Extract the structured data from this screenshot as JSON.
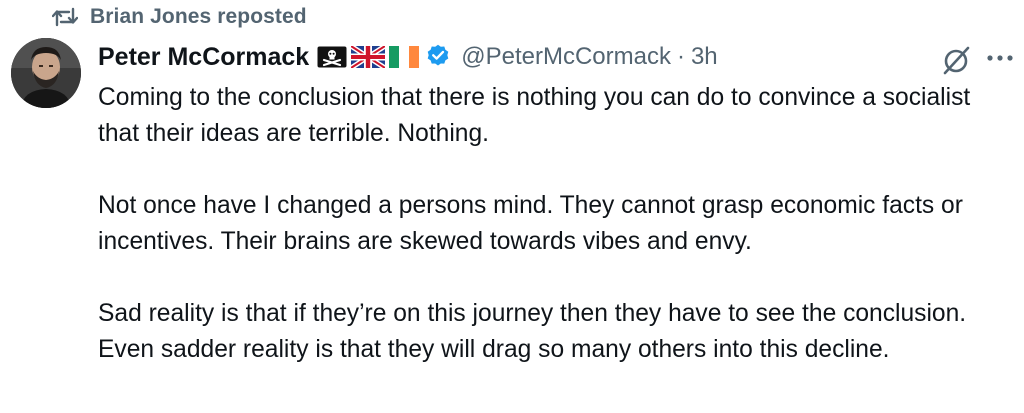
{
  "social_context": {
    "icon": "repost-icon",
    "text": "Brian Jones reposted"
  },
  "author": {
    "display_name": "Peter McCormack",
    "name_badges": [
      "skull-crossbones-flag-icon",
      "uk-flag-icon",
      "ireland-flag-icon"
    ],
    "verified_icon": "verified-badge-icon",
    "handle": "@PeterMcCormack",
    "separator": "·",
    "timestamp": "3h"
  },
  "actions": {
    "grok_icon": "grok-icon",
    "more_icon": "more-options-icon"
  },
  "tweet": {
    "paragraphs": [
      "Coming to the conclusion that there is nothing you can do to convince a socialist that their ideas are terrible. Nothing.",
      "Not once have I changed a persons mind. They cannot grasp economic facts or incentives. Their brains are skewed towards vibes and envy.",
      "Sad reality is that if they’re on this journey then they have to see the conclusion. Even sadder reality is that they will drag so many others into this decline."
    ]
  },
  "colors": {
    "text_primary": "#0f1419",
    "text_secondary": "#536471",
    "verified_blue": "#1d9bf0",
    "background": "#ffffff"
  }
}
